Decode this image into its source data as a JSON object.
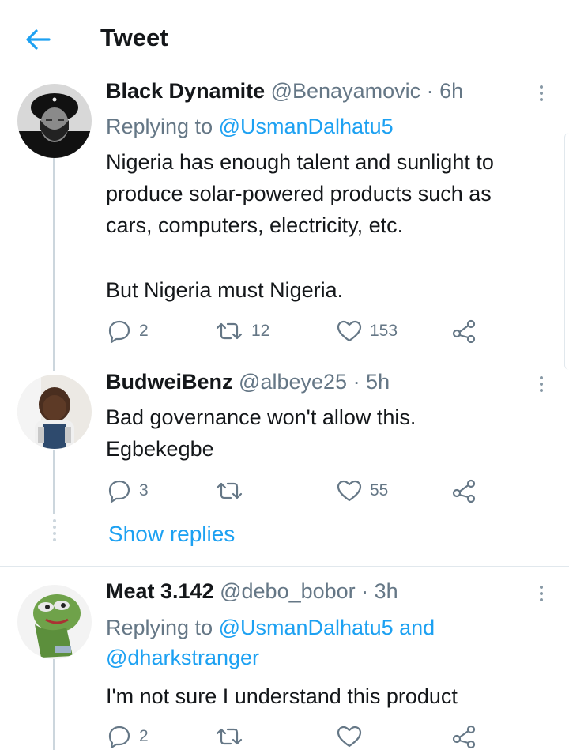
{
  "header": {
    "title": "Tweet",
    "back_icon": "arrow-left-icon"
  },
  "colors": {
    "accent": "#1da1f2",
    "secondary_text": "#657786",
    "primary_text": "#14171a",
    "thread_line": "#ccd6dd"
  },
  "tweets": [
    {
      "name": "Black Dynamite",
      "handle": "@Benayamovic",
      "time": "· 6h",
      "reply_prefix": "Replying to ",
      "reply_to": "@UsmanDalhatu5",
      "reply_line2": "",
      "text_lines": [
        "Nigeria has enough talent and sunlight to",
        "produce solar-powered products such as",
        "cars, computers, electricity, etc.",
        "",
        "But Nigeria must Nigeria."
      ],
      "replies": "2",
      "retweets": "12",
      "likes": "153"
    },
    {
      "name": "BudweiBenz",
      "handle": "@albeye25",
      "time": "· 5h",
      "text_lines": [
        "Bad governance won't allow this.",
        "Egbekegbe"
      ],
      "replies": "3",
      "retweets": "",
      "likes": "55"
    },
    {
      "name": "Meat 3.142",
      "handle": "@debo_bobor",
      "time": "· 3h",
      "reply_prefix": "Replying to ",
      "reply_to": "@UsmanDalhatu5 and",
      "reply_line2": "@dharkstranger",
      "text_lines": [
        "I'm not sure I understand this product"
      ],
      "replies": "2",
      "retweets": "",
      "likes": ""
    }
  ],
  "show_replies": "Show replies"
}
